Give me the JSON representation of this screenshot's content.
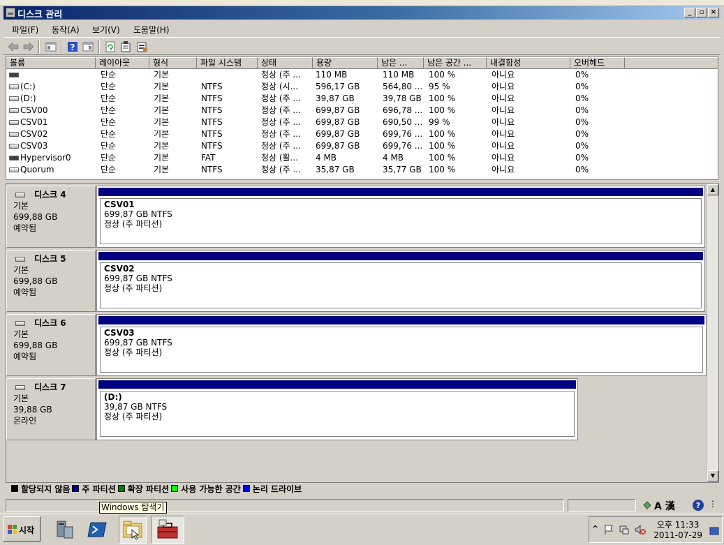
{
  "window": {
    "title": "디스크 관리",
    "min_label": "_",
    "max_label": "▫",
    "close_label": "×"
  },
  "menu": [
    "파일(F)",
    "동작(A)",
    "보기(V)",
    "도움말(H)"
  ],
  "toolbar": {
    "icons": [
      "back-icon",
      "forward-icon",
      "console-tree-icon",
      "help-icon",
      "properties-pane-icon",
      "refresh-icon",
      "properties-icon",
      "export-icon"
    ]
  },
  "columns": [
    "볼륨",
    "레이아웃",
    "형식",
    "파일 시스템",
    "상태",
    "용량",
    "남은 ...",
    "남은 공간 ...",
    "내결함성",
    "오버헤드"
  ],
  "volumes": [
    {
      "name": "",
      "layout": "단순",
      "type": "기본",
      "fs": "",
      "status": "정상 (주 ...",
      "capacity": "110 MB",
      "free": "110 MB",
      "free_pct": "100 %",
      "fault": "아니요",
      "overhead": "0%",
      "icon": "dark"
    },
    {
      "name": "(C:)",
      "layout": "단순",
      "type": "기본",
      "fs": "NTFS",
      "status": "정상 (시...",
      "capacity": "596,17 GB",
      "free": "564,80 ...",
      "free_pct": "95 %",
      "fault": "아니요",
      "overhead": "0%",
      "icon": "light"
    },
    {
      "name": "(D:)",
      "layout": "단순",
      "type": "기본",
      "fs": "NTFS",
      "status": "정상 (주 ...",
      "capacity": "39,87 GB",
      "free": "39,78 GB",
      "free_pct": "100 %",
      "fault": "아니요",
      "overhead": "0%",
      "icon": "light"
    },
    {
      "name": "CSV00",
      "layout": "단순",
      "type": "기본",
      "fs": "NTFS",
      "status": "정상 (주 ...",
      "capacity": "699,87 GB",
      "free": "696,78 ...",
      "free_pct": "100 %",
      "fault": "아니요",
      "overhead": "0%",
      "icon": "light"
    },
    {
      "name": "CSV01",
      "layout": "단순",
      "type": "기본",
      "fs": "NTFS",
      "status": "정상 (주 ...",
      "capacity": "699,87 GB",
      "free": "690,50 ...",
      "free_pct": "99 %",
      "fault": "아니요",
      "overhead": "0%",
      "icon": "light"
    },
    {
      "name": "CSV02",
      "layout": "단순",
      "type": "기본",
      "fs": "NTFS",
      "status": "정상 (주 ...",
      "capacity": "699,87 GB",
      "free": "699,76 ...",
      "free_pct": "100 %",
      "fault": "아니요",
      "overhead": "0%",
      "icon": "light"
    },
    {
      "name": "CSV03",
      "layout": "단순",
      "type": "기본",
      "fs": "NTFS",
      "status": "정상 (주 ...",
      "capacity": "699,87 GB",
      "free": "699,76 ...",
      "free_pct": "100 %",
      "fault": "아니요",
      "overhead": "0%",
      "icon": "light"
    },
    {
      "name": "Hypervisor0",
      "layout": "단순",
      "type": "기본",
      "fs": "FAT",
      "status": "정상 (활...",
      "capacity": "4 MB",
      "free": "4 MB",
      "free_pct": "100 %",
      "fault": "아니요",
      "overhead": "0%",
      "icon": "dark"
    },
    {
      "name": "Quorum",
      "layout": "단순",
      "type": "기본",
      "fs": "NTFS",
      "status": "정상 (주 ...",
      "capacity": "35,87 GB",
      "free": "35,77 GB",
      "free_pct": "100 %",
      "fault": "아니요",
      "overhead": "0%",
      "icon": "light"
    }
  ],
  "disks": [
    {
      "name": "디스크 4",
      "kind": "기본",
      "size": "699,88 GB",
      "state": "예약됨",
      "part_name": "CSV01",
      "part_size": "699,87 GB NTFS",
      "part_status": "정상 (주 파티션)"
    },
    {
      "name": "디스크 5",
      "kind": "기본",
      "size": "699,88 GB",
      "state": "예약됨",
      "part_name": "CSV02",
      "part_size": "699,87 GB NTFS",
      "part_status": "정상 (주 파티션)"
    },
    {
      "name": "디스크 6",
      "kind": "기본",
      "size": "699,88 GB",
      "state": "예약됨",
      "part_name": "CSV03",
      "part_size": "699,87 GB NTFS",
      "part_status": "정상 (주 파티션)"
    },
    {
      "name": "디스크 7",
      "kind": "기본",
      "size": "39,88 GB",
      "state": "온라인",
      "part_name": "(D:)",
      "part_size": "39,87 GB NTFS",
      "part_status": "정상 (주 파티션)"
    }
  ],
  "legend": [
    {
      "label": "할당되지 않음",
      "color": "#000000"
    },
    {
      "label": "주 파티션",
      "color": "#000080"
    },
    {
      "label": "확장 파티션",
      "color": "#008000"
    },
    {
      "label": "사용 가능한 공간",
      "color": "#00ff00"
    },
    {
      "label": "논리 드라이브",
      "color": "#0000ff"
    }
  ],
  "tooltip": "Windows 탐색기",
  "taskbar": {
    "start_label": "시작",
    "time": "오후 11:33",
    "date": "2011-07-29",
    "tray_icons": [
      "show-hidden-icon",
      "flag-icon",
      "network-icon",
      "volume-muted-icon"
    ]
  },
  "statusbar": {
    "lang_label": "A 漢"
  }
}
